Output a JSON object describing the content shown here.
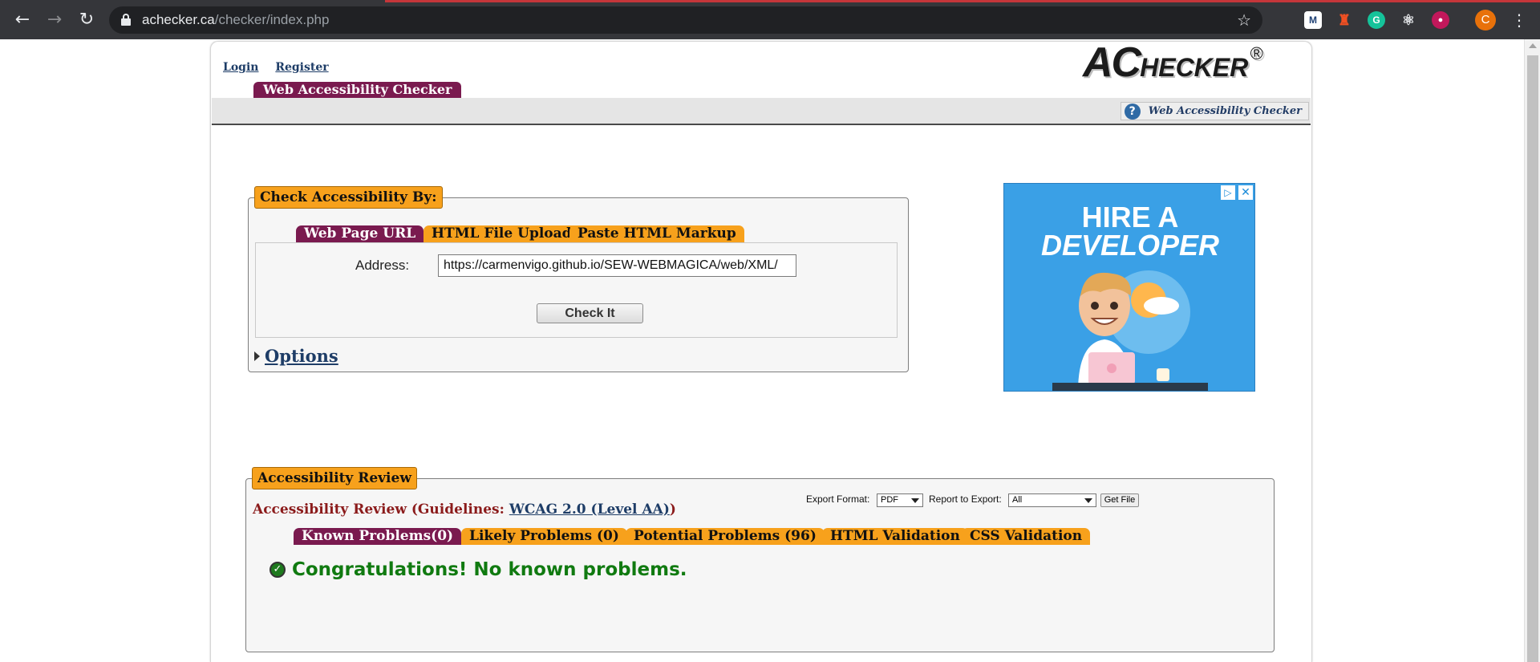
{
  "browser": {
    "url_domain": "achecker.ca",
    "url_path": "/checker/index.php",
    "avatar_letter": "C"
  },
  "header": {
    "links": [
      "Login",
      "Register"
    ],
    "logo_main": "AC",
    "logo_rest": "HECKER",
    "logo_reg": "®",
    "main_tab": "Web Accessibility Checker",
    "help_label": "Web Accessibility Checker"
  },
  "check": {
    "legend": "Check Accessibility By:",
    "tabs": [
      "Web Page URL",
      "HTML File Upload",
      "Paste HTML Markup"
    ],
    "address_label": "Address:",
    "address_value": "https://carmenvigo.github.io/SEW-WEBMAGICA/web/XML/",
    "check_button": "Check It",
    "options_label": "Options"
  },
  "ad": {
    "line1": "HIRE A",
    "line2": "DEVELOPER"
  },
  "review": {
    "legend": "Accessibility Review",
    "title_prefix": "Accessibility Review (Guidelines: ",
    "guideline_link": "WCAG 2.0 (Level AA)",
    "title_suffix": ")",
    "export_format_label": "Export Format:",
    "export_format_value": "PDF",
    "report_label": "Report to Export:",
    "report_value": "All",
    "get_file": "Get File",
    "tabs": [
      "Known Problems(0)",
      "Likely Problems (0)",
      "Potential Problems (96)",
      "HTML Validation",
      "CSS Validation"
    ],
    "message": "Congratulations! No known problems."
  },
  "colors": {
    "accent_orange": "#f7a11c",
    "accent_plum": "#7a1a4f",
    "link_blue": "#1e3d67",
    "success_green": "#107a10"
  }
}
